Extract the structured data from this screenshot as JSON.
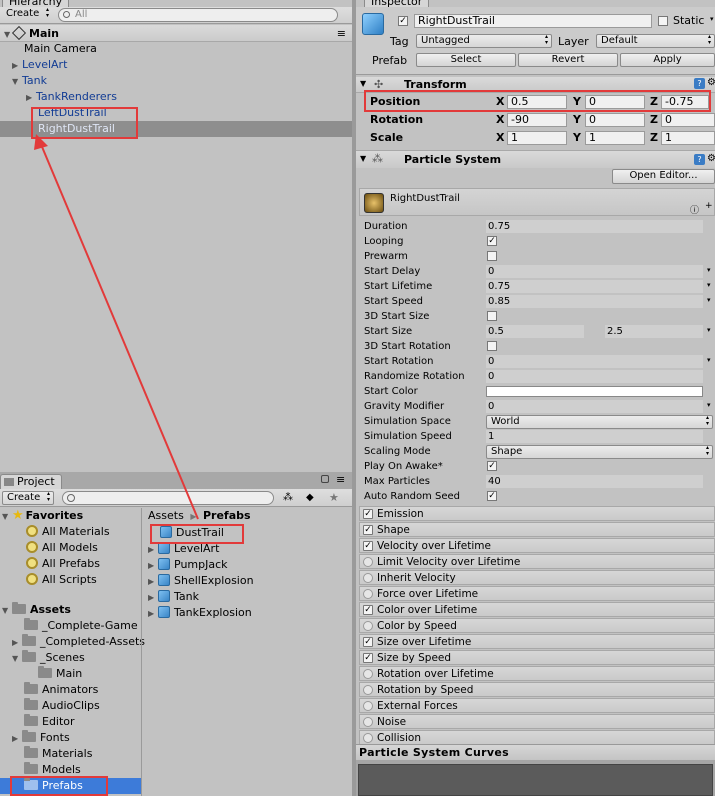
{
  "hierarchy": {
    "tab": "Hierarchy",
    "create": "Create",
    "search_placeholder": "All",
    "scene": "Main",
    "items": [
      {
        "label": "Main Camera"
      },
      {
        "label": "LevelArt"
      },
      {
        "label": "Tank"
      },
      {
        "label": "TankRenderers"
      },
      {
        "label": "LeftDustTrail"
      },
      {
        "label": "RightDustTrail"
      }
    ]
  },
  "project": {
    "tab": "Project",
    "create": "Create",
    "favorites": {
      "title": "Favorites",
      "items": [
        "All Materials",
        "All Models",
        "All Prefabs",
        "All Scripts"
      ]
    },
    "assets": {
      "title": "Assets",
      "items": [
        "_Complete-Game",
        "_Completed-Assets",
        "_Scenes",
        "Main",
        "Animators",
        "AudioClips",
        "Editor",
        "Fonts",
        "Materials",
        "Models",
        "Prefabs"
      ]
    },
    "breadcrumb": {
      "root": "Assets",
      "current": "Prefabs"
    },
    "files": [
      "DustTrail",
      "LevelArt",
      "PumpJack",
      "ShellExplosion",
      "Tank",
      "TankExplosion"
    ]
  },
  "inspector": {
    "tab": "Inspector",
    "object_name": "RightDustTrail",
    "static_label": "Static",
    "tag_label": "Tag",
    "tag_value": "Untagged",
    "layer_label": "Layer",
    "layer_value": "Default",
    "prefab_label": "Prefab",
    "prefab_select": "Select",
    "prefab_revert": "Revert",
    "prefab_apply": "Apply",
    "transform": {
      "title": "Transform",
      "rows": [
        {
          "label": "Position",
          "x": "0.5",
          "y": "0",
          "z": "-0.75"
        },
        {
          "label": "Rotation",
          "x": "-90",
          "y": "0",
          "z": "0"
        },
        {
          "label": "Scale",
          "x": "1",
          "y": "1",
          "z": "1"
        }
      ]
    },
    "particle_system": {
      "title": "Particle System",
      "open_editor": "Open Editor...",
      "sub_title": "RightDustTrail",
      "props": [
        {
          "label": "Duration",
          "value": "0.75"
        },
        {
          "label": "Looping",
          "value": "✓"
        },
        {
          "label": "Prewarm",
          "value": ""
        },
        {
          "label": "Start Delay",
          "value": "0"
        },
        {
          "label": "Start Lifetime",
          "value": "0.75"
        },
        {
          "label": "Start Speed",
          "value": "0.85"
        },
        {
          "label": "3D Start Size",
          "value": ""
        },
        {
          "label": "Start Size",
          "value": "0.5",
          "value2": "2.5"
        },
        {
          "label": "3D Start Rotation",
          "value": ""
        },
        {
          "label": "Start Rotation",
          "value": "0"
        },
        {
          "label": "Randomize Rotation",
          "value": "0"
        },
        {
          "label": "Start Color",
          "value": ""
        },
        {
          "label": "Gravity Modifier",
          "value": "0"
        },
        {
          "label": "Simulation Space",
          "value": "World"
        },
        {
          "label": "Simulation Speed",
          "value": "1"
        },
        {
          "label": "Scaling Mode",
          "value": "Shape"
        },
        {
          "label": "Play On Awake*",
          "value": "✓"
        },
        {
          "label": "Max Particles",
          "value": "40"
        },
        {
          "label": "Auto Random Seed",
          "value": "✓"
        }
      ],
      "modules": [
        {
          "label": "Emission",
          "check": "✓"
        },
        {
          "label": "Shape",
          "check": "✓"
        },
        {
          "label": "Velocity over Lifetime",
          "check": "✓"
        },
        {
          "label": "Limit Velocity over Lifetime",
          "check": ""
        },
        {
          "label": "Inherit Velocity",
          "check": ""
        },
        {
          "label": "Force over Lifetime",
          "check": ""
        },
        {
          "label": "Color over Lifetime",
          "check": "✓"
        },
        {
          "label": "Color by Speed",
          "check": ""
        },
        {
          "label": "Size over Lifetime",
          "check": "✓"
        },
        {
          "label": "Size by Speed",
          "check": "✓"
        },
        {
          "label": "Rotation over Lifetime",
          "check": ""
        },
        {
          "label": "Rotation by Speed",
          "check": ""
        },
        {
          "label": "External Forces",
          "check": ""
        },
        {
          "label": "Noise",
          "check": ""
        },
        {
          "label": "Collision",
          "check": ""
        }
      ],
      "curves_title": "Particle System Curves"
    }
  },
  "colors": {
    "highlight_box": "#e23a3a",
    "selection": "#3d7bd9",
    "arrow": "#e23a3a"
  }
}
